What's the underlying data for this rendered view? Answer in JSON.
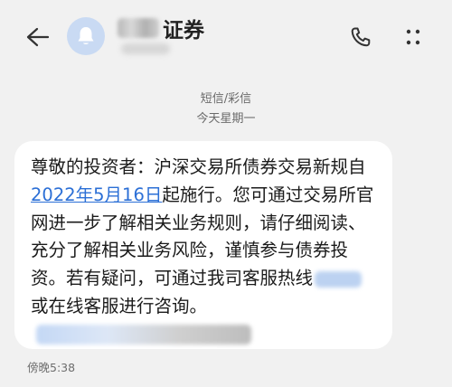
{
  "header": {
    "contact_name_visible": "证券",
    "back_icon": "arrow-left-icon",
    "avatar_icon": "bell-icon",
    "call_icon": "phone-icon",
    "more_icon": "more-vertical-icon"
  },
  "meta": {
    "channel": "短信/彩信",
    "date": "今天星期一"
  },
  "message": {
    "part1": "尊敬的投资者：沪深交易所债券交易新规自",
    "date_link": "2022年5月16日",
    "part2": "起施行。您可通过交易所官网进一步了解相关业务规则，请仔细阅读、充分了解相关业务风险，谨慎参与债券投资。若有疑问，可通过我司客服热线",
    "part3": "或在线客服进行咨询。",
    "time": "傍晚5:38"
  },
  "colors": {
    "background": "#f1f1f1",
    "bubble": "#ffffff",
    "link": "#2b6fd6",
    "avatar": "#c9daf3"
  }
}
